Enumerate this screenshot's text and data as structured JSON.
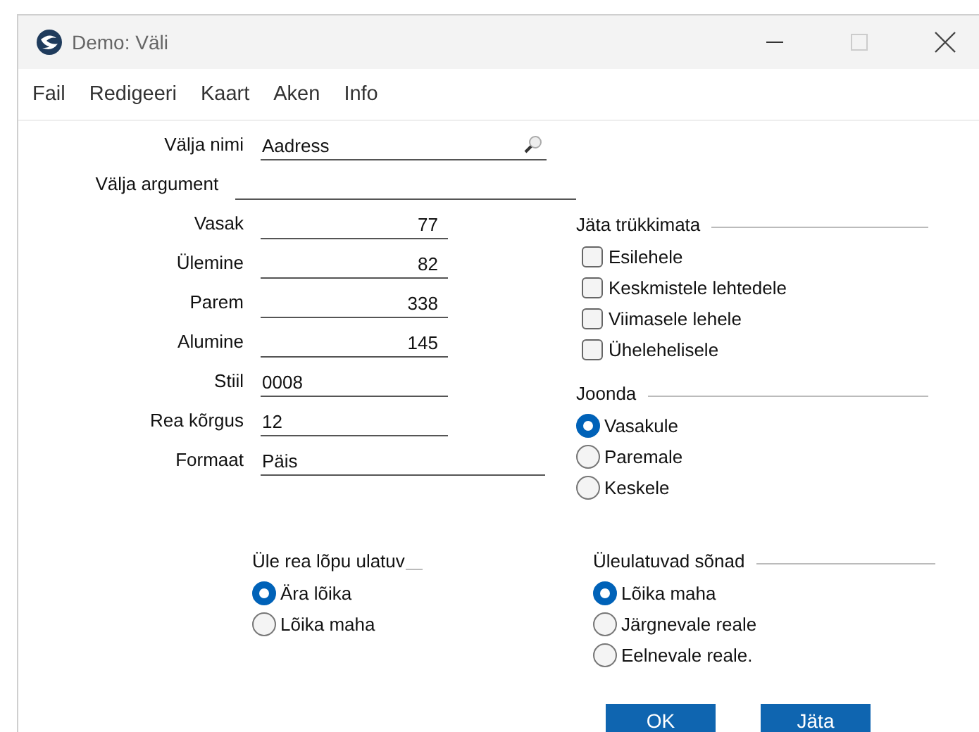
{
  "window": {
    "title": "Demo: Väli"
  },
  "menu": [
    "Fail",
    "Redigeeri",
    "Kaart",
    "Aken",
    "Info"
  ],
  "fields": [
    {
      "label": "Välja nimi",
      "value": "Aadress",
      "kind": "lookup"
    },
    {
      "label": "Välja argument",
      "kind": "long"
    },
    {
      "label": "Vasak",
      "value": "77",
      "kind": "number"
    },
    {
      "label": "Ülemine",
      "value": "82",
      "kind": "number"
    },
    {
      "label": "Parem",
      "value": "338",
      "kind": "number"
    },
    {
      "label": "Alumine",
      "value": "145",
      "kind": "number"
    },
    {
      "label": "Stiil",
      "value": "0008",
      "kind": "short"
    },
    {
      "label": "Rea kõrgus",
      "value": "12",
      "kind": "short"
    },
    {
      "label": "Formaat",
      "value": "Päis",
      "kind": "medium"
    }
  ],
  "skip_printing": {
    "title": "Jäta trükkimata",
    "options": [
      {
        "label": "Esilehele",
        "checked": false
      },
      {
        "label": "Keskmistele lehtedele",
        "checked": false
      },
      {
        "label": "Viimasele lehele",
        "checked": false
      },
      {
        "label": "Ühelehelisele",
        "checked": false
      }
    ]
  },
  "align": {
    "title": "Joonda",
    "options": [
      {
        "label": "Vasakule",
        "selected": true
      },
      {
        "label": "Paremale",
        "selected": false
      },
      {
        "label": "Keskele",
        "selected": false
      }
    ]
  },
  "overflow": {
    "title": "Üle rea lõpu ulatuv",
    "options": [
      {
        "label": "Ära lõika",
        "selected": true
      },
      {
        "label": "Lõika maha",
        "selected": false
      }
    ]
  },
  "overflow_words": {
    "title": "Üleulatuvad sõnad",
    "options": [
      {
        "label": "Lõika maha",
        "selected": true
      },
      {
        "label": "Järgnevale reale",
        "selected": false
      },
      {
        "label": "Eelnevale reale.",
        "selected": false
      }
    ]
  },
  "buttons": [
    "OK",
    "Jäta"
  ]
}
